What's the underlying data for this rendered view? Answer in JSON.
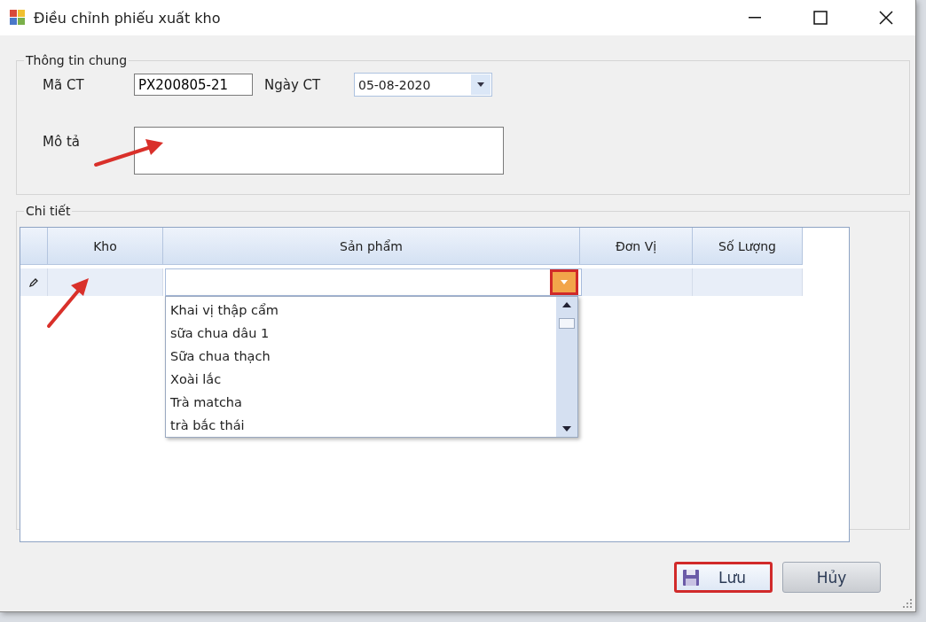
{
  "window": {
    "title": "Điều chỉnh phiếu xuất kho"
  },
  "general": {
    "title": "Thông tin chung",
    "fields": [
      {
        "kind": "text",
        "label": "Mã CT",
        "value": "PX200805-21"
      },
      {
        "kind": "date",
        "label": "Ngày CT",
        "value": "05-08-2020"
      },
      {
        "kind": "textarea",
        "label": "Mô tả"
      }
    ]
  },
  "details": {
    "title": "Chi tiết",
    "columns": [
      "Kho",
      "Sản phẩm",
      "Đơn Vị",
      "Số Lượng"
    ],
    "product_dropdown": {
      "expanded": true,
      "highlighted": true,
      "options": [
        "Khai vị thập cẩm",
        "sữa chua dâu 1",
        "Sữa chua thạch",
        "Xoài lắc",
        "Trà matcha",
        "trà bắc thái"
      ]
    }
  },
  "buttons": [
    {
      "kind": "save",
      "label": "Lưu",
      "highlighted": true
    },
    {
      "kind": "cancel",
      "label": "Hủy",
      "highlighted": false
    }
  ]
}
